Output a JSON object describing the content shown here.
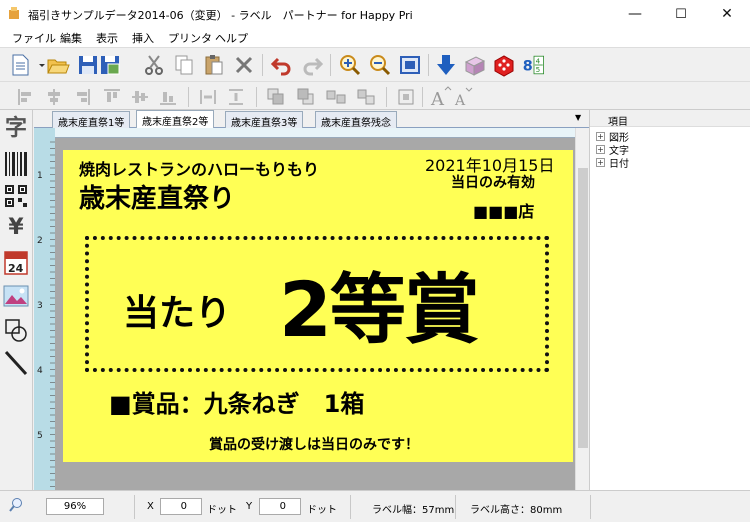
{
  "window": {
    "title": "福引きサンプルデータ2014-06（変更） - ラベル　パートナー for Happy Pri",
    "minimize": "—",
    "maximize": "☐",
    "close": "✕"
  },
  "menu": [
    "ファイル",
    "編集",
    "表示",
    "挿入",
    "プリンタ",
    "ヘルプ"
  ],
  "toolbar": {
    "page_numbers_top": "4",
    "page_number_left": "8",
    "page_numbers_bottom": "5"
  },
  "palette": {
    "text_tool": "字",
    "currency_tool": "¥",
    "calendar_tool": "24"
  },
  "tabs": [
    "歳末産直祭1等",
    "歳末産直祭2等",
    "歳末産直祭3等",
    "歳末産直祭残念"
  ],
  "ruler": {
    "marks": [
      "1",
      "2",
      "3",
      "4",
      "5"
    ]
  },
  "label": {
    "shop_line": "焼肉レストランのハローもりもり",
    "event_name": "歳末産直祭り",
    "date": "2021年10月15日",
    "validity": "当日のみ有効",
    "store": "■■■店",
    "prize_prefix": "当たり",
    "prize_rank": "2等賞",
    "item": "■賞品：九条ねぎ　1箱",
    "notice": "賞品の受け渡しは当日のみです！"
  },
  "panel": {
    "header": "項目",
    "items": [
      "図形",
      "文字",
      "日付"
    ]
  },
  "status": {
    "zoom": "96%",
    "x_label": "X",
    "x_value": "0",
    "y_label": "Y",
    "y_value": "0",
    "unit": "ドット",
    "width": "ラベル幅：57mm",
    "height": "ラベル高さ：80mm"
  },
  "colors": {
    "label_bg": "#ffff55",
    "ruler": "#b8dce6",
    "canvas_bg": "#a8a8a8"
  }
}
